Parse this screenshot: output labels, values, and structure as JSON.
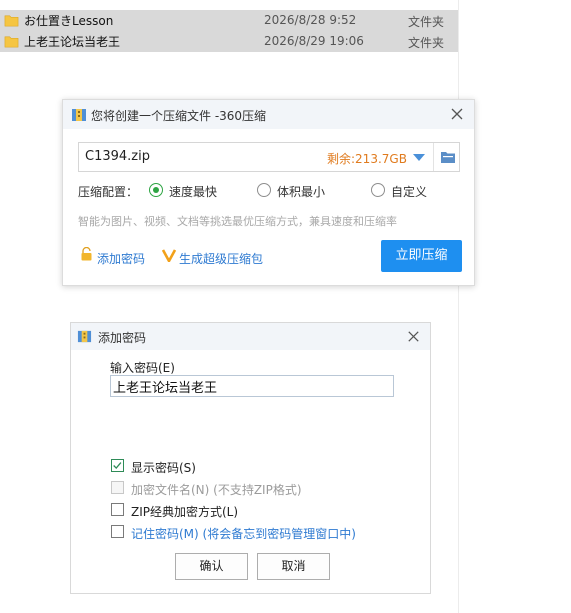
{
  "explorer": {
    "files": [
      {
        "name": "お仕置きLesson",
        "date": "2026/8/28 9:52",
        "type": "文件夹"
      },
      {
        "name": "上老王论坛当老王",
        "date": "2026/8/29 19:06",
        "type": "文件夹"
      }
    ]
  },
  "compress_dialog": {
    "title": "您将创建一个压缩文件 -360压缩",
    "filename": "C1394.zip",
    "free_space": "剩余:213.7GB",
    "config_label": "压缩配置：",
    "options": [
      {
        "label": "速度最快",
        "selected": true
      },
      {
        "label": "体积最小",
        "selected": false
      },
      {
        "label": "自定义",
        "selected": false
      }
    ],
    "hint": "智能为图片、视频、文档等挑选最优压缩方式，兼具速度和压缩率",
    "add_password": "添加密码",
    "super_pack": "生成超级压缩包",
    "compress_button": "立即压缩"
  },
  "password_dialog": {
    "title": "添加密码",
    "input_label": "输入密码(E)",
    "password_value": "上老王论坛当老王",
    "checkboxes": [
      {
        "label": "显示密码(S)",
        "checked": true,
        "disabled": false
      },
      {
        "label": "加密文件名(N) (不支持ZIP格式)",
        "checked": false,
        "disabled": true
      },
      {
        "label": "ZIP经典加密方式(L)",
        "checked": false,
        "disabled": false
      },
      {
        "label": "记住密码(M) (将会备忘到密码管理窗口中)",
        "checked": false,
        "disabled": false
      }
    ],
    "ok_button": "确认",
    "cancel_button": "取消"
  },
  "colors": {
    "accent_blue": "#1e8ff0",
    "link_blue": "#2e7ad1",
    "free_space_orange": "#e07b1e",
    "radio_green": "#2ea443",
    "folder_yellow": "#f5c542"
  }
}
